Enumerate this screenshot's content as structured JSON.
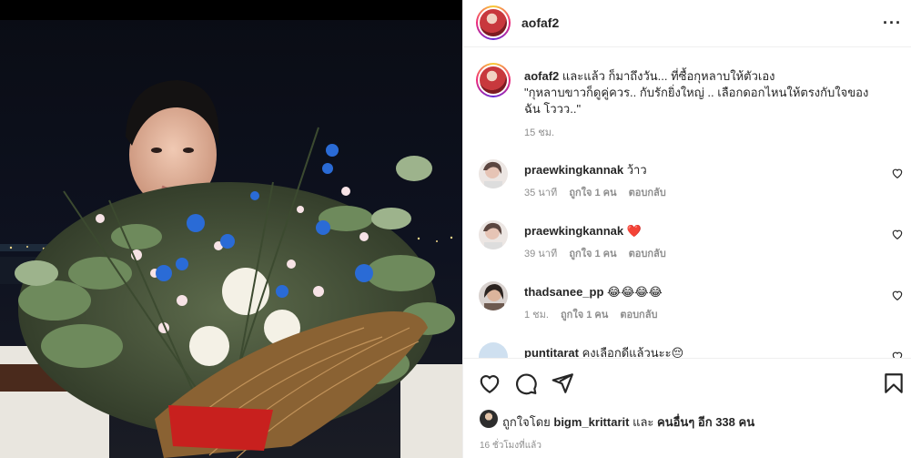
{
  "post": {
    "username": "aofaf2",
    "photo_alt": "photo"
  },
  "caption": {
    "username": "aofaf2",
    "text_line1": "และแล้ว ก็มาถึงวัน... ที่ซื้อกุหลาบให้ตัวเอง",
    "text_line2": "\"กุหลาบขาวก็ดูคู่ควร.. กับรักยิ่งใหญ่ .. เลือกดอกไหนให้ตรงกับใจของ",
    "text_line3": "ฉัน โววว..\"",
    "time": "15 ชม."
  },
  "comments": [
    {
      "username": "praewkingkannak",
      "text": "ว้าว",
      "time": "35 นาที",
      "likes": "ถูกใจ 1 คน",
      "reply": "ตอบกลับ"
    },
    {
      "username": "praewkingkannak",
      "text": "❤️",
      "time": "39 นาที",
      "likes": "ถูกใจ 1 คน",
      "reply": "ตอบกลับ"
    },
    {
      "username": "thadsanee_pp",
      "text": "😂😂😂😂",
      "time": "1 ชม.",
      "likes": "ถูกใจ 1 คน",
      "reply": "ตอบกลับ"
    },
    {
      "username": "puntitarat",
      "text": "คงเลือกดีแล้วนะะ😔",
      "time": "",
      "likes": "",
      "reply": ""
    }
  ],
  "likes_summary": {
    "prefix": "ถูกใจโดย",
    "user": "bigm_krittarit",
    "middle": "และ",
    "others": "คนอื่นๆ อีก 338 คน"
  },
  "timestamp": "16 ชั่วโมงที่แล้ว",
  "colors": {
    "heart_red": "#ed4956",
    "text": "#262626",
    "muted": "#8e8e8e"
  }
}
